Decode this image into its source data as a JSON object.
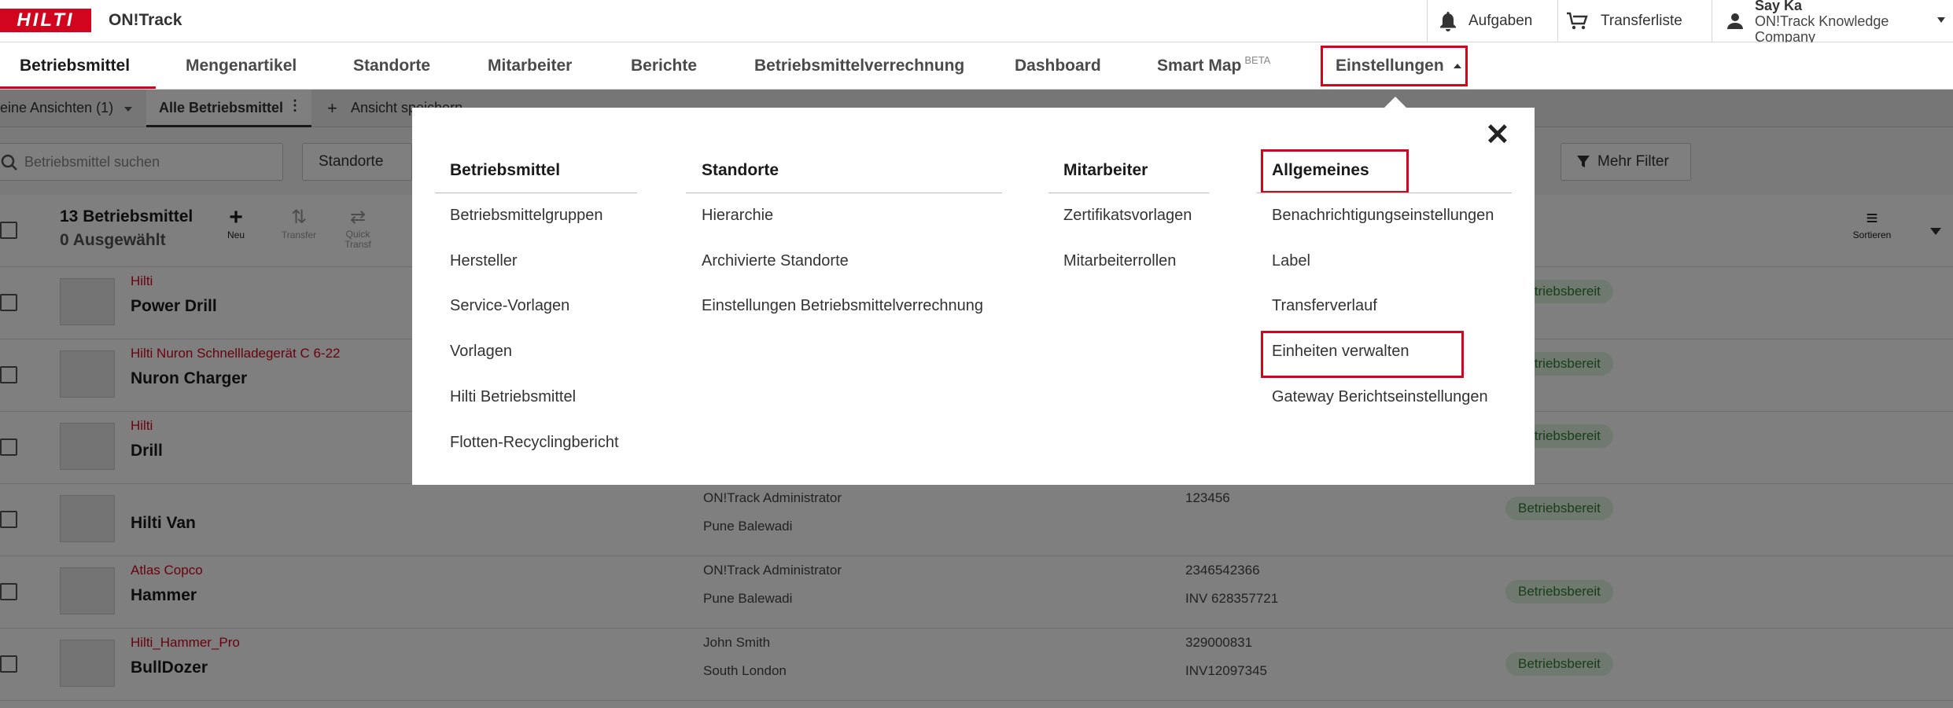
{
  "topbar": {
    "logo": "HILTI",
    "app_name": "ON!Track",
    "tasks_label": "Aufgaben",
    "transfer_label": "Transferliste",
    "user_name": "Say Ka",
    "company": "ON!Track Knowledge Company"
  },
  "nav": {
    "items": [
      "Betriebsmittel",
      "Mengenartikel",
      "Standorte",
      "Mitarbeiter",
      "Berichte",
      "Betriebsmittelverrechnung",
      "Dashboard",
      "Smart Map",
      "Einstellungen"
    ],
    "beta": "BETA"
  },
  "views": {
    "my_views": "eine Ansichten (1)",
    "all_assets": "Alle Betriebsmittel",
    "save_view": "Ansicht speichern"
  },
  "filters": {
    "search_placeholder": "Betriebsmittel suchen",
    "locations": "Standorte",
    "more_filters": "Mehr Filter"
  },
  "list": {
    "count": "13 Betriebsmittel",
    "selected": "0 Ausgewählt",
    "new": "Neu",
    "transfer": "Transfer",
    "quick_transfer": "Quick Transf",
    "sort": "Sortieren",
    "rows": [
      {
        "brand": "Hilti",
        "name": "Power Drill",
        "person": "",
        "location": "",
        "id": "",
        "inv": "",
        "status": "Betriebsbereit"
      },
      {
        "brand": "Hilti Nuron Schnellladegerät C 6-22",
        "name": "Nuron Charger",
        "person": "",
        "location": "",
        "id": "",
        "inv": "",
        "status": "Betriebsbereit"
      },
      {
        "brand": "Hilti",
        "name": "Drill",
        "person": "",
        "location": "",
        "id": "",
        "inv": "",
        "status": "Betriebsbereit"
      },
      {
        "brand": "",
        "name": "Hilti Van",
        "person": "ON!Track Administrator",
        "location": "Pune Balewadi",
        "id": "123456",
        "inv": "",
        "status": "Betriebsbereit"
      },
      {
        "brand": "Atlas Copco",
        "name": "Hammer",
        "person": "ON!Track Administrator",
        "location": "Pune Balewadi",
        "id": "2346542366",
        "inv": "INV 628357721",
        "status": "Betriebsbereit"
      },
      {
        "brand": "Hilti_Hammer_Pro",
        "name": "BullDozer",
        "person": "John Smith",
        "location": "South London",
        "id": "329000831",
        "inv": "INV12097345",
        "status": "Betriebsbereit"
      }
    ]
  },
  "menu": {
    "columns": [
      {
        "title": "Betriebsmittel",
        "items": [
          "Betriebsmittelgruppen",
          "Hersteller",
          "Service-Vorlagen",
          "Vorlagen",
          "Hilti Betriebsmittel",
          "Flotten-Recyclingbericht"
        ]
      },
      {
        "title": "Standorte",
        "items": [
          "Hierarchie",
          "Archivierte Standorte",
          "Einstellungen Betriebsmittelverrechnung"
        ]
      },
      {
        "title": "Mitarbeiter",
        "items": [
          "Zertifikatsvorlagen",
          "Mitarbeiterrollen"
        ]
      },
      {
        "title": "Allgemeines",
        "items": [
          "Benachrichtigungseinstellungen",
          "Label",
          "Transferverlauf",
          "Einheiten verwalten",
          "Gateway Berichtseinstellungen"
        ]
      }
    ],
    "close": "✕"
  },
  "colors": {
    "brand_red": "#d2051e",
    "status_green": "#2e7d32"
  }
}
